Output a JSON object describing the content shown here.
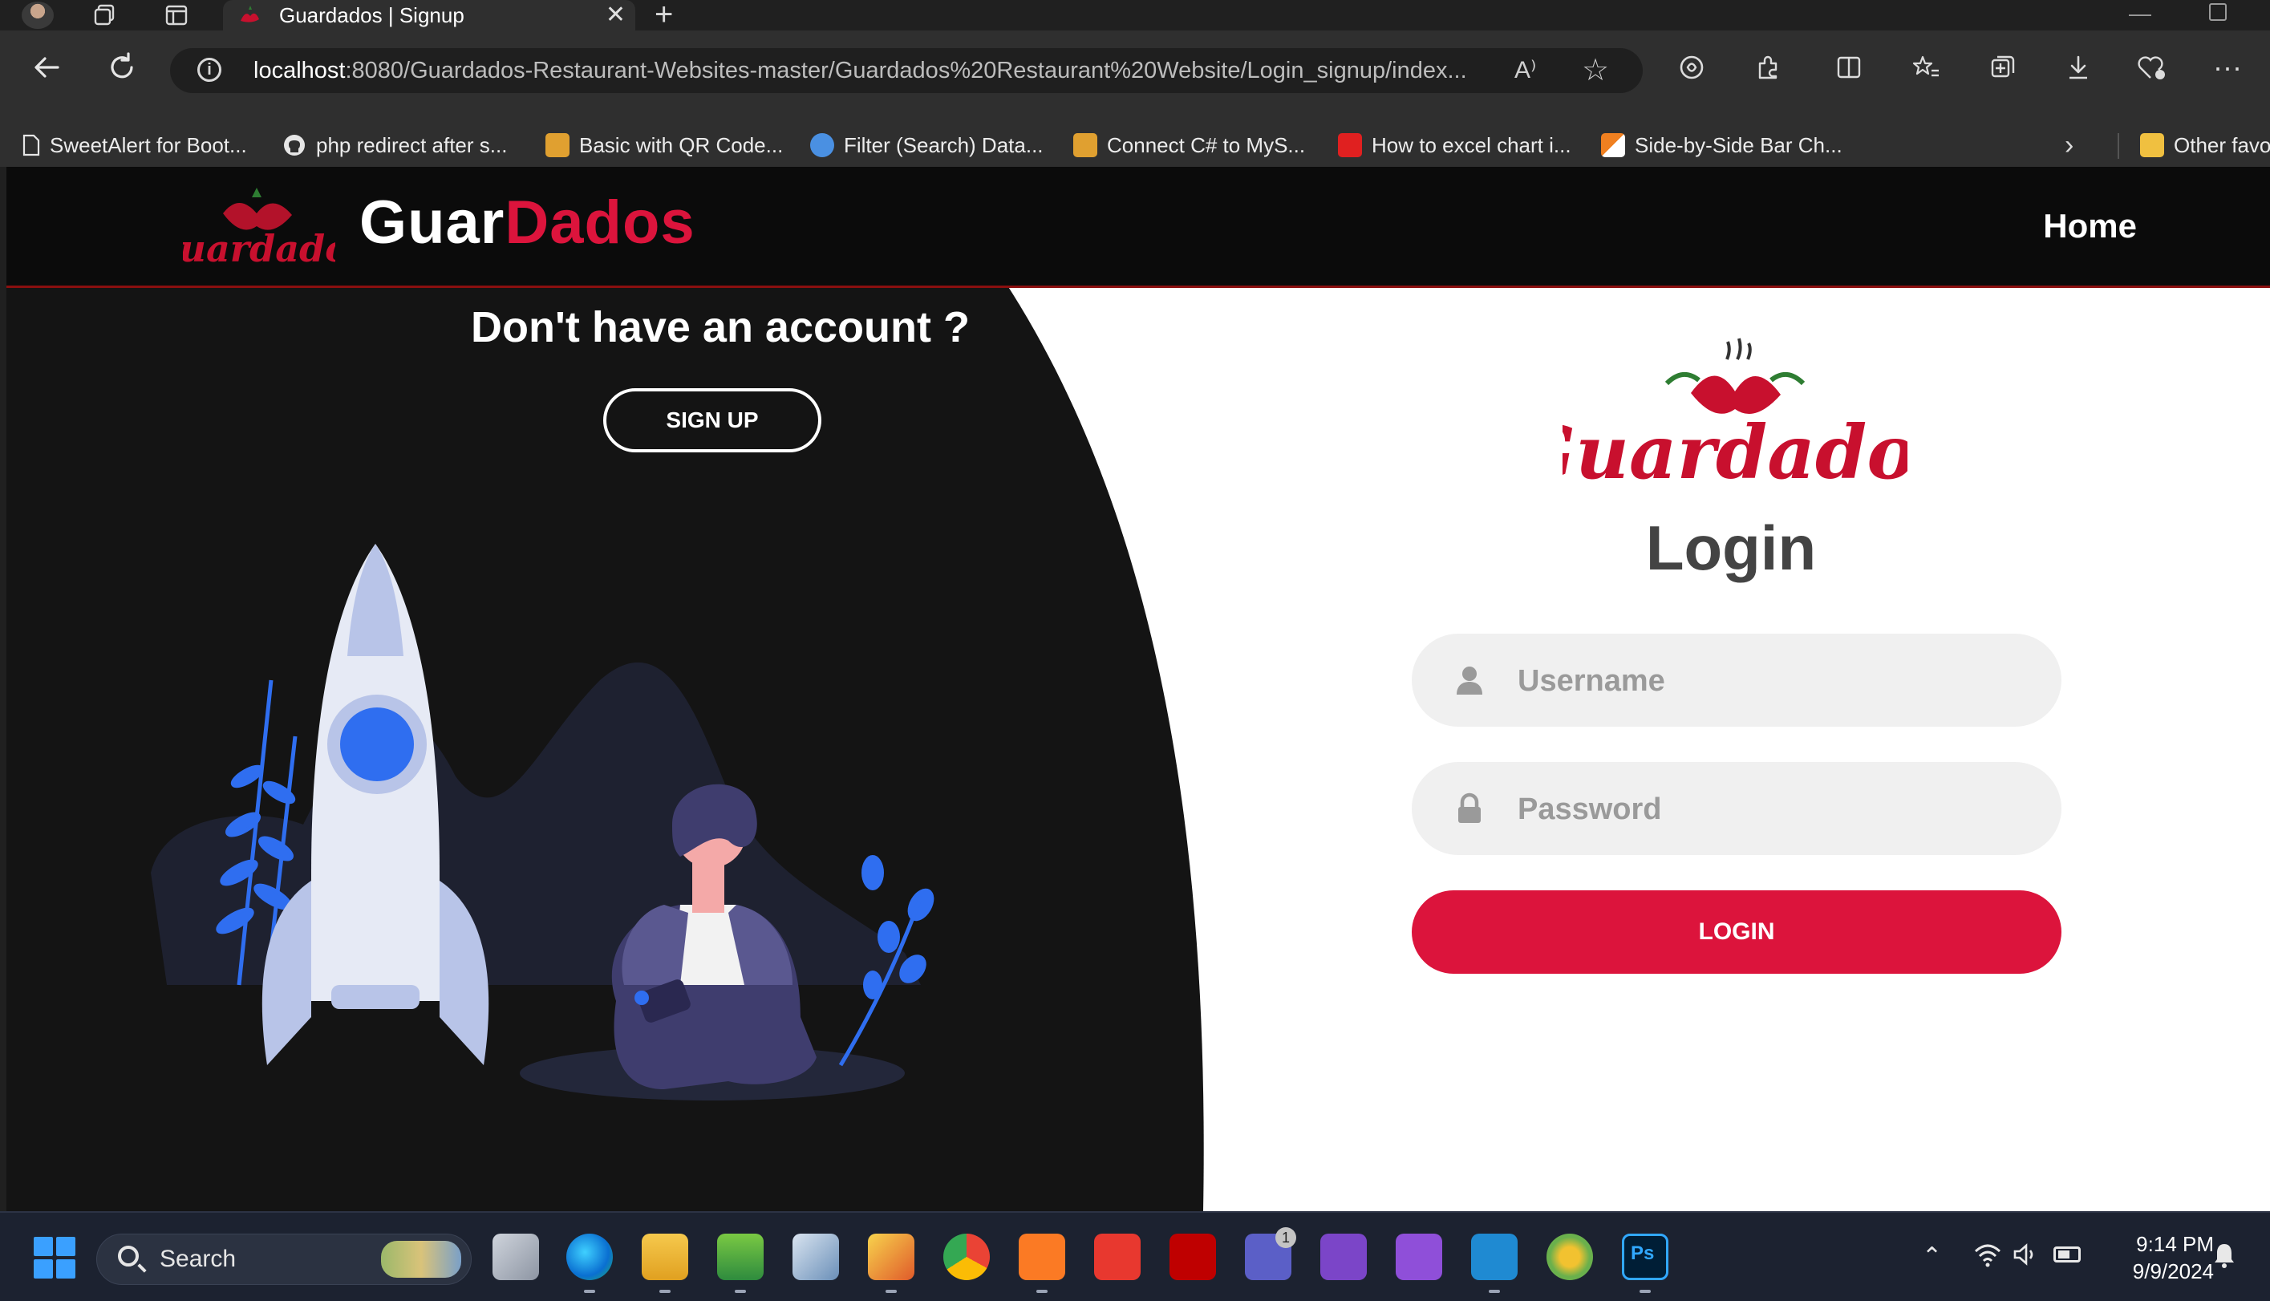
{
  "browser": {
    "tab_title": "Guardados | Signup",
    "tab_close": "✕",
    "new_tab": "+",
    "url_host": "localhost",
    "url_rest": ":8080/Guardados-Restaurant-Websites-master/Guardados%20Restaurant%20Website/Login_signup/index...",
    "read_aloud": "A⁾",
    "bookmarks": [
      {
        "label": "SweetAlert for Boot...",
        "color": "#ffffff"
      },
      {
        "label": "php redirect after s...",
        "color": "#e6e6e6"
      },
      {
        "label": "Basic with QR Code...",
        "color": "#e0a030"
      },
      {
        "label": "Filter (Search) Data...",
        "color": "#4a90e2"
      },
      {
        "label": "Connect C# to MyS...",
        "color": "#e0a030"
      },
      {
        "label": "How to excel chart i...",
        "color": "#e02020"
      },
      {
        "label": "Side-by-Side Bar Ch...",
        "color": "#f08020"
      },
      {
        "label": "Other favo",
        "color": "#f0c040"
      }
    ],
    "bookmarks_more": "›"
  },
  "site": {
    "brand_part1": "Guar",
    "brand_part2": "Dados",
    "nav_home": "Home",
    "signup_heading": "Don't have an account ?",
    "signup_button": "SIGN UP",
    "login_title": "Login",
    "username_placeholder": "Username",
    "password_placeholder": "Password",
    "login_button": "LOGIN",
    "accent_color": "#dc143c"
  },
  "taskbar": {
    "search_label": "Search",
    "tray_up": "⌃",
    "time": "9:14 PM",
    "date": "9/9/2024",
    "teams_badge": "1"
  }
}
